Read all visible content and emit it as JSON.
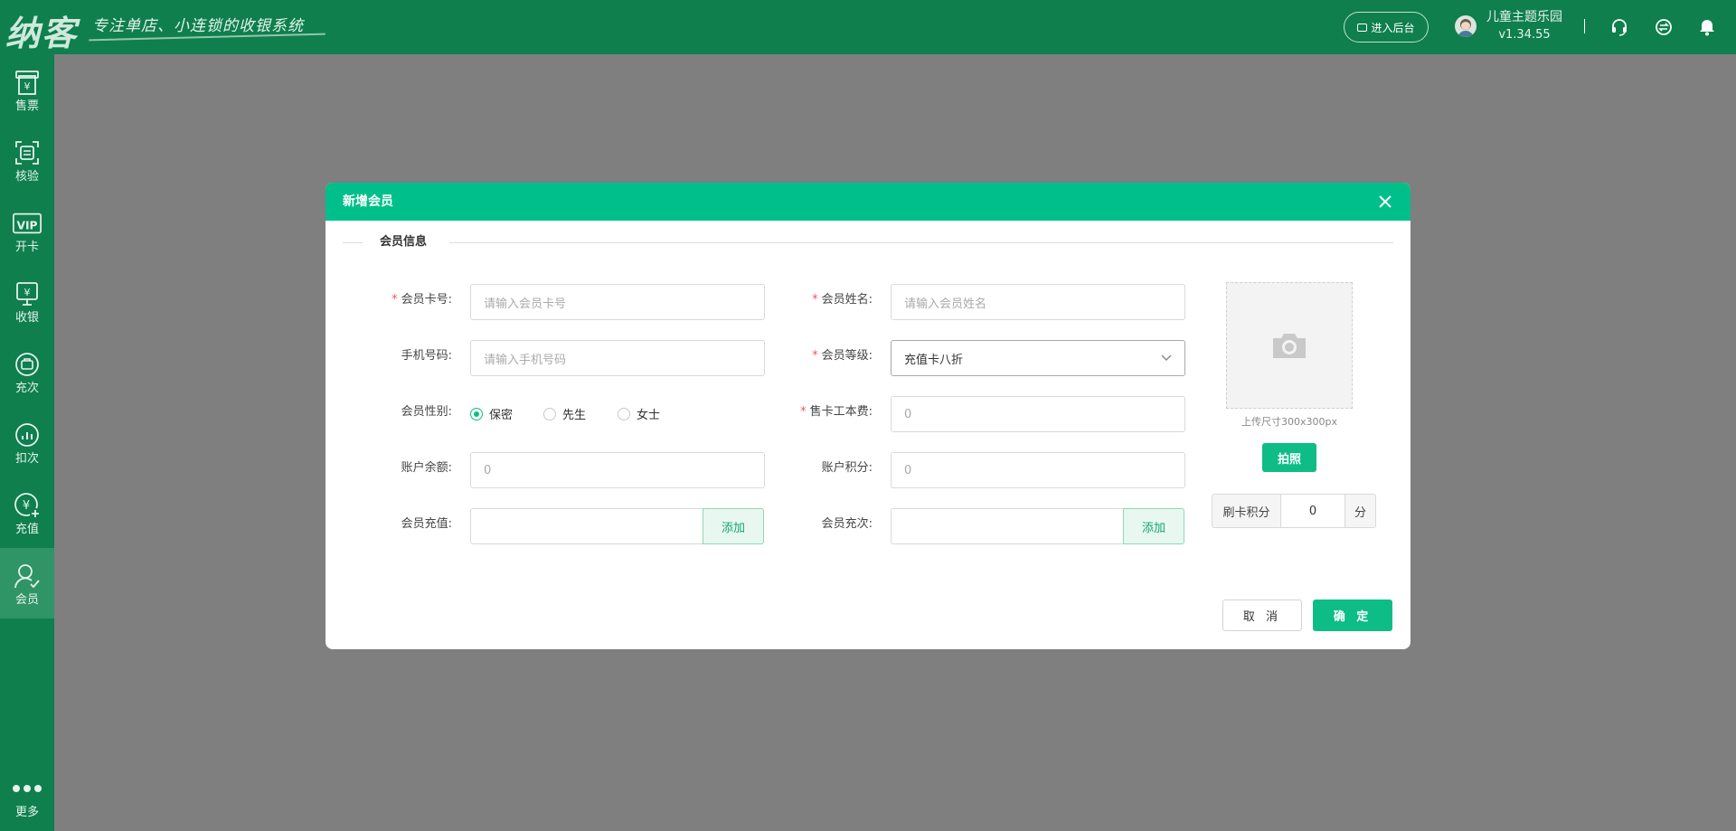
{
  "header": {
    "logo": "纳客",
    "slogan": "专注单店、小连锁的收银系统",
    "backend_button": "进入后台",
    "store_name": "儿童主题乐园",
    "version": "v1.34.55",
    "icons": [
      "headset-icon",
      "sync-icon",
      "bell-icon"
    ]
  },
  "sidebar": {
    "items": [
      {
        "label": "售票",
        "icon": "ticket-icon"
      },
      {
        "label": "核验",
        "icon": "scan-verify-icon"
      },
      {
        "label": "开卡",
        "icon": "vip-card-icon"
      },
      {
        "label": "收银",
        "icon": "cashier-icon"
      },
      {
        "label": "充次",
        "icon": "recharge-times-icon"
      },
      {
        "label": "扣次",
        "icon": "deduct-times-icon"
      },
      {
        "label": "充值",
        "icon": "recharge-icon"
      },
      {
        "label": "会员",
        "icon": "member-icon"
      }
    ],
    "active": "会员",
    "more_label": "更多"
  },
  "modal": {
    "title": "新增会员",
    "section_title": "会员信息",
    "fields": {
      "card_no": {
        "label": "会员卡号:",
        "placeholder": "请输入会员卡号",
        "required": true
      },
      "name": {
        "label": "会员姓名:",
        "placeholder": "请输入会员姓名",
        "required": true
      },
      "phone": {
        "label": "手机号码:",
        "placeholder": "请输入手机号码"
      },
      "level": {
        "label": "会员等级:",
        "value": "充值卡八折",
        "required": true
      },
      "gender": {
        "label": "会员性别:",
        "options": [
          "保密",
          "先生",
          "女士"
        ],
        "selected": "保密"
      },
      "card_fee": {
        "label": "售卡工本费:",
        "value": "0",
        "required": true
      },
      "balance": {
        "label": "账户余额:",
        "value": "0"
      },
      "points": {
        "label": "账户积分:",
        "value": "0"
      },
      "recharge": {
        "label": "会员充值:",
        "button": "添加"
      },
      "recharge_times": {
        "label": "会员充次:",
        "button": "添加"
      }
    },
    "photo": {
      "hint": "上传尺寸300x300px",
      "button": "拍照"
    },
    "swipe_points": {
      "label": "刷卡积分",
      "value": "0",
      "unit": "分"
    },
    "buttons": {
      "cancel": "取 消",
      "confirm": "确 定"
    }
  },
  "colors": {
    "brand_dark": "#0e7f4d",
    "accent": "#00bf8a",
    "required": "#f35656",
    "overlay": "#7f7f7f"
  }
}
